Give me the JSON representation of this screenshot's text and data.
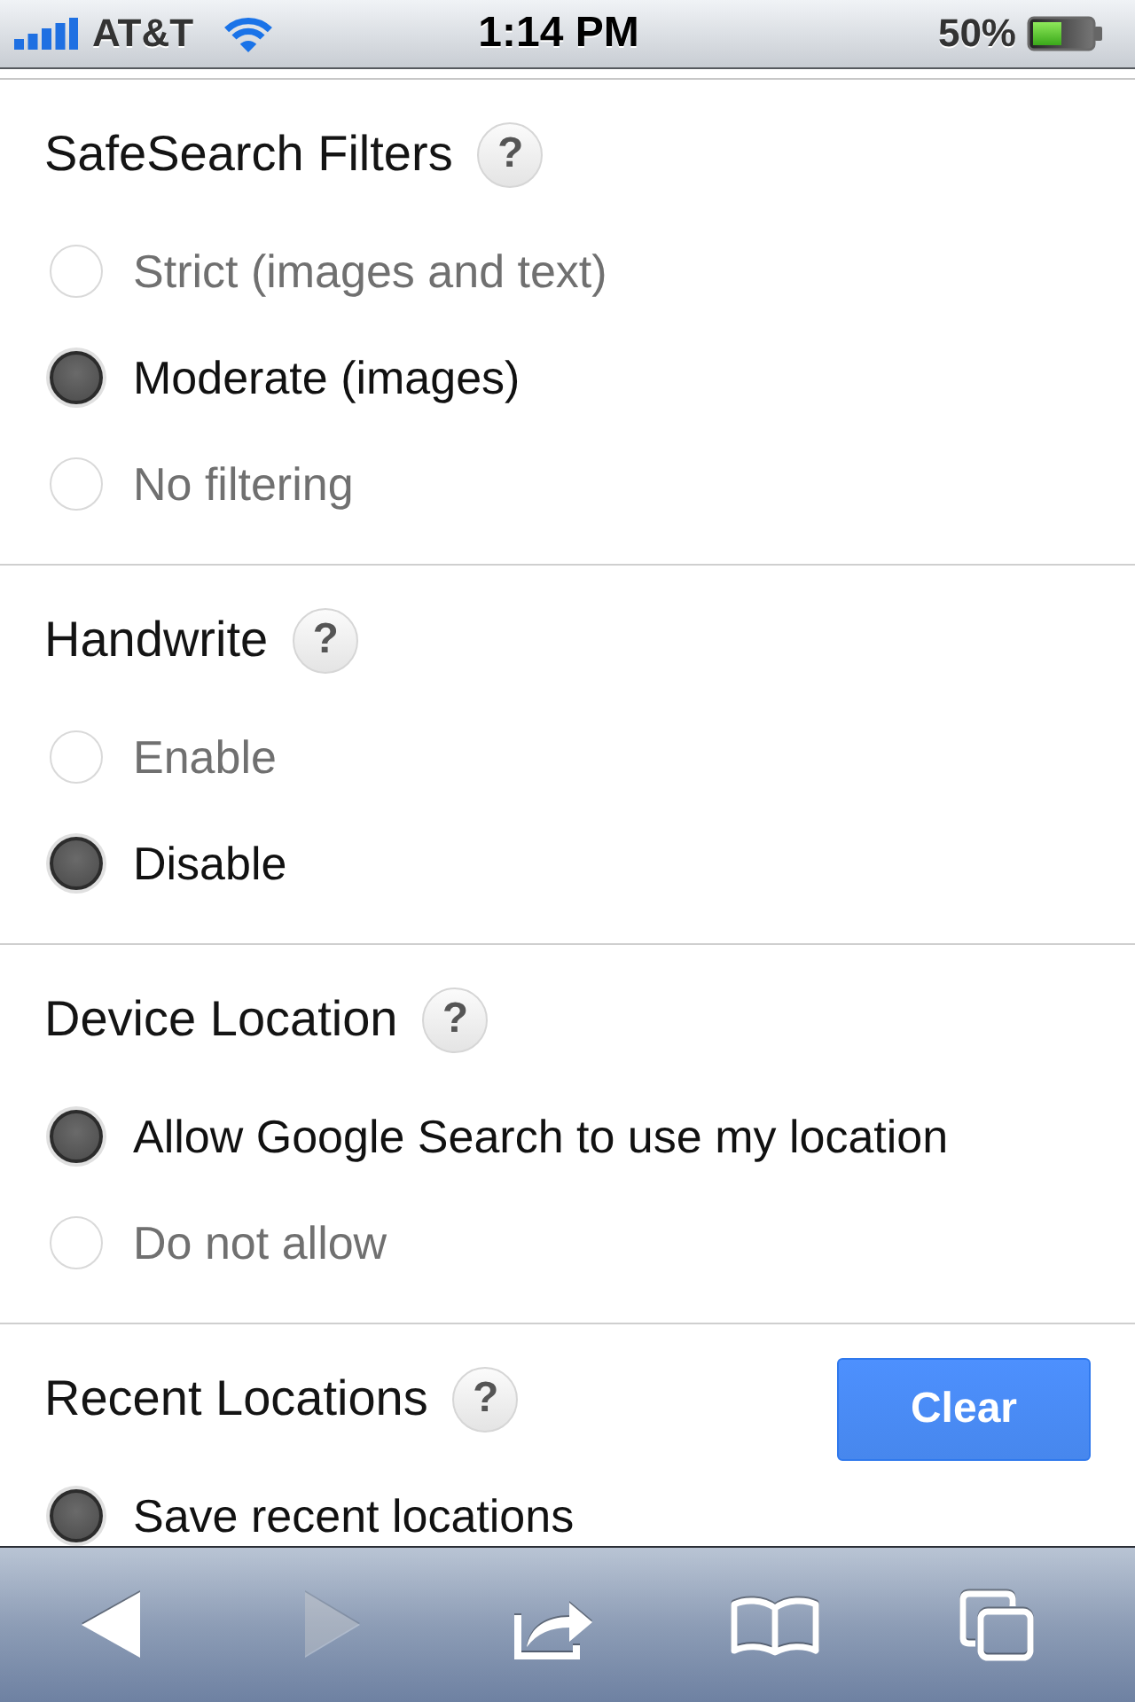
{
  "status_bar": {
    "carrier": "AT&T",
    "time": "1:14 PM",
    "battery": "50%"
  },
  "sections": [
    {
      "title": "SafeSearch Filters",
      "help": "?",
      "options": [
        {
          "label": "Strict (images and text)",
          "selected": false
        },
        {
          "label": "Moderate (images)",
          "selected": true
        },
        {
          "label": "No filtering",
          "selected": false
        }
      ]
    },
    {
      "title": "Handwrite",
      "help": "?",
      "options": [
        {
          "label": "Enable",
          "selected": false
        },
        {
          "label": "Disable",
          "selected": true
        }
      ]
    },
    {
      "title": "Device Location",
      "help": "?",
      "options": [
        {
          "label": "Allow Google Search to use my location",
          "selected": true
        },
        {
          "label": "Do not allow",
          "selected": false
        }
      ]
    },
    {
      "title": "Recent Locations",
      "help": "?",
      "button": "Clear",
      "options": [
        {
          "label": "Save recent locations",
          "selected": true
        }
      ]
    }
  ],
  "toolbar": [
    {
      "kind": "back",
      "disabled": false
    },
    {
      "kind": "forward",
      "disabled": true
    },
    {
      "kind": "share",
      "disabled": false
    },
    {
      "kind": "bookmarks",
      "disabled": false
    },
    {
      "kind": "tabs",
      "disabled": false
    }
  ]
}
